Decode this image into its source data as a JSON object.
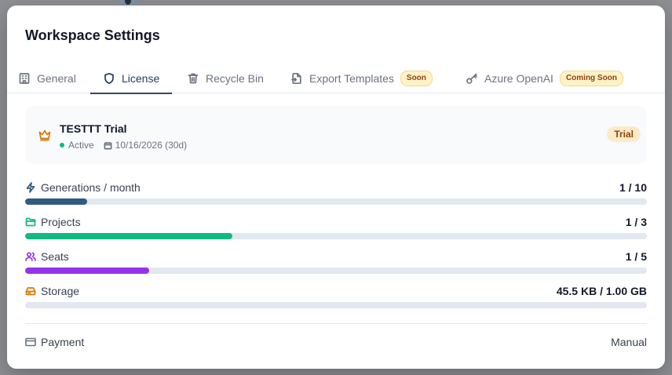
{
  "modal": {
    "title": "Workspace Settings"
  },
  "tabs": [
    {
      "label": "General",
      "icon": "building-icon",
      "active": false
    },
    {
      "label": "License",
      "icon": "shield-icon",
      "active": true
    },
    {
      "label": "Recycle Bin",
      "icon": "trash-icon",
      "active": false
    },
    {
      "label": "Export Templates",
      "icon": "file-export-icon",
      "active": false,
      "badge": "Soon"
    },
    {
      "label": "Azure OpenAI",
      "icon": "key-icon",
      "active": false,
      "badge": "Coming Soon"
    }
  ],
  "license": {
    "name": "TESTTT Trial",
    "status": "Active",
    "expiry": "10/16/2026 (30d)",
    "badge": "Trial",
    "icon": "crown-icon"
  },
  "usage": [
    {
      "label": "Generations / month",
      "value": "1 / 10",
      "fraction": 0.1,
      "color": "#2f5b80",
      "icon": "zap-icon"
    },
    {
      "label": "Projects",
      "value": "1 / 3",
      "fraction": 0.333,
      "color": "#10b981",
      "icon": "folder-icon"
    },
    {
      "label": "Seats",
      "value": "1 / 5",
      "fraction": 0.2,
      "color": "#9333ea",
      "icon": "users-icon"
    },
    {
      "label": "Storage",
      "value": "45.5 KB / 1.00 GB",
      "fraction": 0.0,
      "color": "#d97706",
      "icon": "hard-drive-icon"
    }
  ],
  "payment": {
    "label": "Payment",
    "value": "Manual",
    "icon": "credit-card-icon"
  },
  "colors": {
    "accent": "#1e3a5f",
    "active_dot": "#10b981",
    "badge_bg": "#fef3c7",
    "badge_text": "#92400e"
  }
}
